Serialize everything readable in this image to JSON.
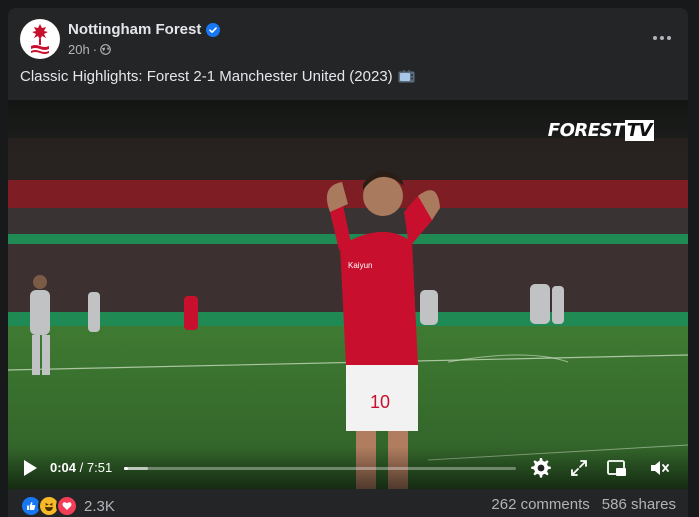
{
  "post": {
    "page_name": "Nottingham Forest",
    "time": "20h",
    "meta_separator": "·",
    "caption": "Classic Highlights: Forest 2-1 Manchester United (2023)"
  },
  "video": {
    "brand_text": "FOREST",
    "brand_tv": "TV",
    "current_time": "0:04",
    "duration": "7:51",
    "progress": 0.009,
    "buffered": 0.06
  },
  "engagement": {
    "reaction_count": "2.3K",
    "comments": "262 comments",
    "shares": "586 shares"
  },
  "colors": {
    "like_blue": "#1877f2",
    "haha_yellow": "#f7b928",
    "love_red": "#f33e58",
    "verified_blue": "#1877f2",
    "forest_red": "#c8102e"
  },
  "icons": [
    "verified-badge-icon",
    "globe-icon",
    "more-icon",
    "tv-emoji-icon",
    "play-icon",
    "settings-icon",
    "fullscreen-icon",
    "pip-icon",
    "mute-icon",
    "like-reaction-icon",
    "haha-reaction-icon",
    "love-reaction-icon"
  ]
}
